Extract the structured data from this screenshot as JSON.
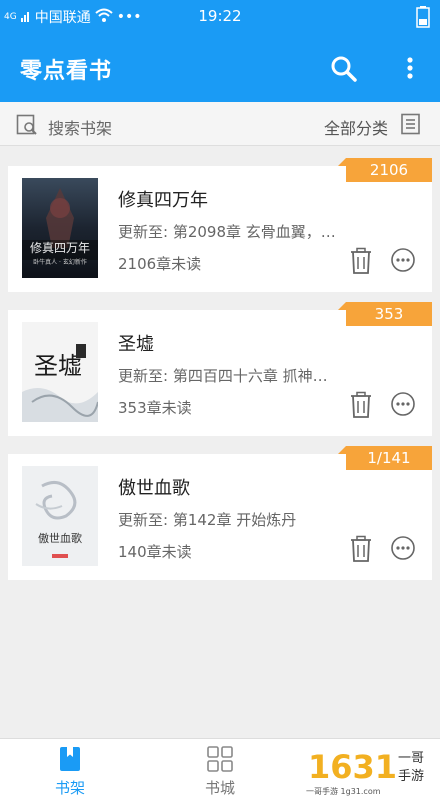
{
  "status": {
    "network": "4G",
    "carrier": "中国联通",
    "time": "19:22"
  },
  "header": {
    "title": "零点看书"
  },
  "searchbar": {
    "search_label": "搜索书架",
    "category_label": "全部分类"
  },
  "books": [
    {
      "title": "修真四万年",
      "update": "更新至: 第2098章 玄骨血翼，…",
      "unread": "2106章未读",
      "badge": "2106"
    },
    {
      "title": "圣墟",
      "update": "更新至: 第四百四十六章 抓神…",
      "unread": "353章未读",
      "badge": "353"
    },
    {
      "title": "傲世血歌",
      "update": "更新至: 第142章 开始炼丹",
      "unread": "140章未读",
      "badge": "1/141"
    }
  ],
  "tabs": [
    {
      "label": "书架"
    },
    {
      "label": "书城"
    }
  ],
  "watermark": {
    "text": "1631",
    "brand": "一哥手游",
    "url": "一哥手游 1g31.com"
  },
  "colors": {
    "primary": "#1a9bf5",
    "badge": "#f7a43a"
  }
}
